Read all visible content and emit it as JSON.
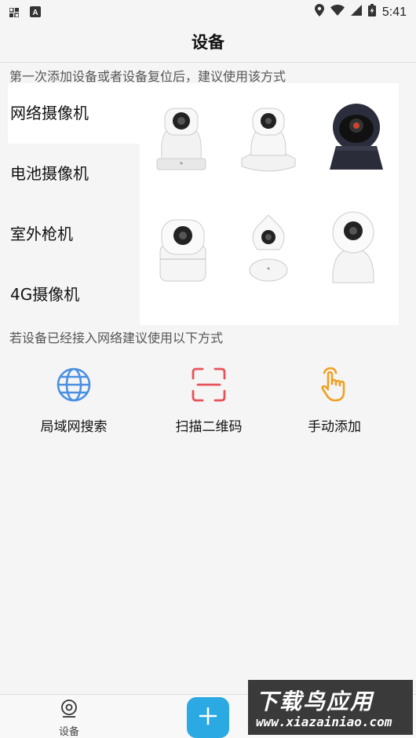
{
  "statusbar": {
    "time": "5:41"
  },
  "header": {
    "title": "设备"
  },
  "hints": {
    "first": "第一次添加设备或者设备复位后，建议使用该方式",
    "second": "若设备已经接入网络建议使用以下方式"
  },
  "device_types": [
    {
      "label": "网络摄像机",
      "active": true
    },
    {
      "label": "电池摄像机",
      "active": false
    },
    {
      "label": "室外枪机",
      "active": false
    },
    {
      "label": "4G摄像机",
      "active": false
    }
  ],
  "actions": [
    {
      "label": "局域网搜索",
      "icon": "globe-icon",
      "color": "#4a90e2"
    },
    {
      "label": "扫描二维码",
      "icon": "scan-qr-icon",
      "color": "#e8525a"
    },
    {
      "label": "手动添加",
      "icon": "hand-pointer-icon",
      "color": "#f0a020"
    }
  ],
  "bottom_nav": {
    "device_label": "设备"
  },
  "fab": {
    "icon": "plus-icon",
    "color": "#2aa9e2"
  },
  "watermark": {
    "title": "下载鸟应用",
    "url": "www.xiazainiao.com"
  }
}
